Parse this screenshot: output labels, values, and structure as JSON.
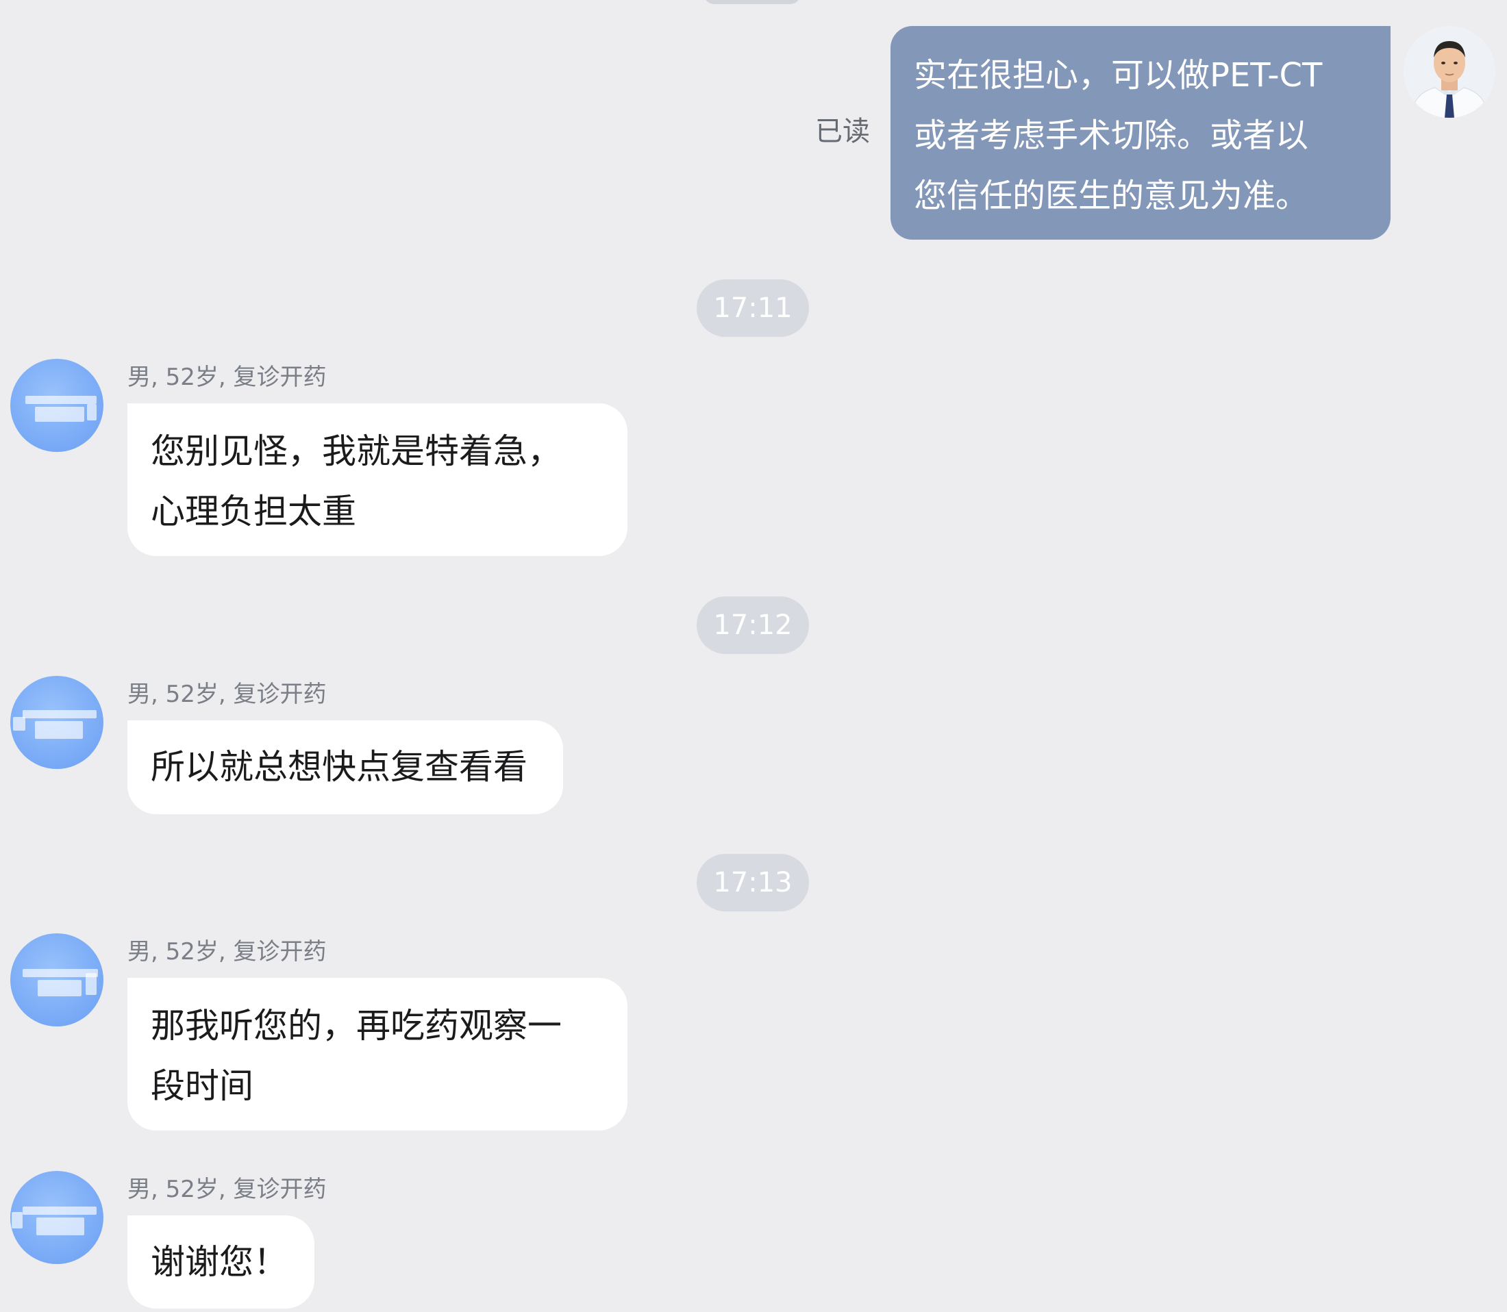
{
  "doctor_message": {
    "lines": [
      "实在很担心，可以做PET-CT",
      "或者考虑手术切除。或者以",
      "您信任的医生的意见为准。"
    ],
    "read_status": "已读",
    "bubble_color": "#8397b9"
  },
  "timestamps": [
    "17:11",
    "17:12",
    "17:13"
  ],
  "patient_meta": "男, 52岁, 复诊开药",
  "patient_messages": [
    {
      "lines": [
        "您别见怪，我就是特着急，",
        "心理负担太重"
      ]
    },
    {
      "lines": [
        "所以就总想快点复查看看"
      ]
    },
    {
      "lines": [
        "那我听您的，再吃药观察一",
        "段时间"
      ]
    },
    {
      "lines": [
        "谢谢您！"
      ]
    }
  ],
  "colors": {
    "background": "#ededf0",
    "incoming_bubble": "#ffffff",
    "timestamp_pill": "#d7dae0",
    "patient_avatar": "#7eaef7"
  }
}
